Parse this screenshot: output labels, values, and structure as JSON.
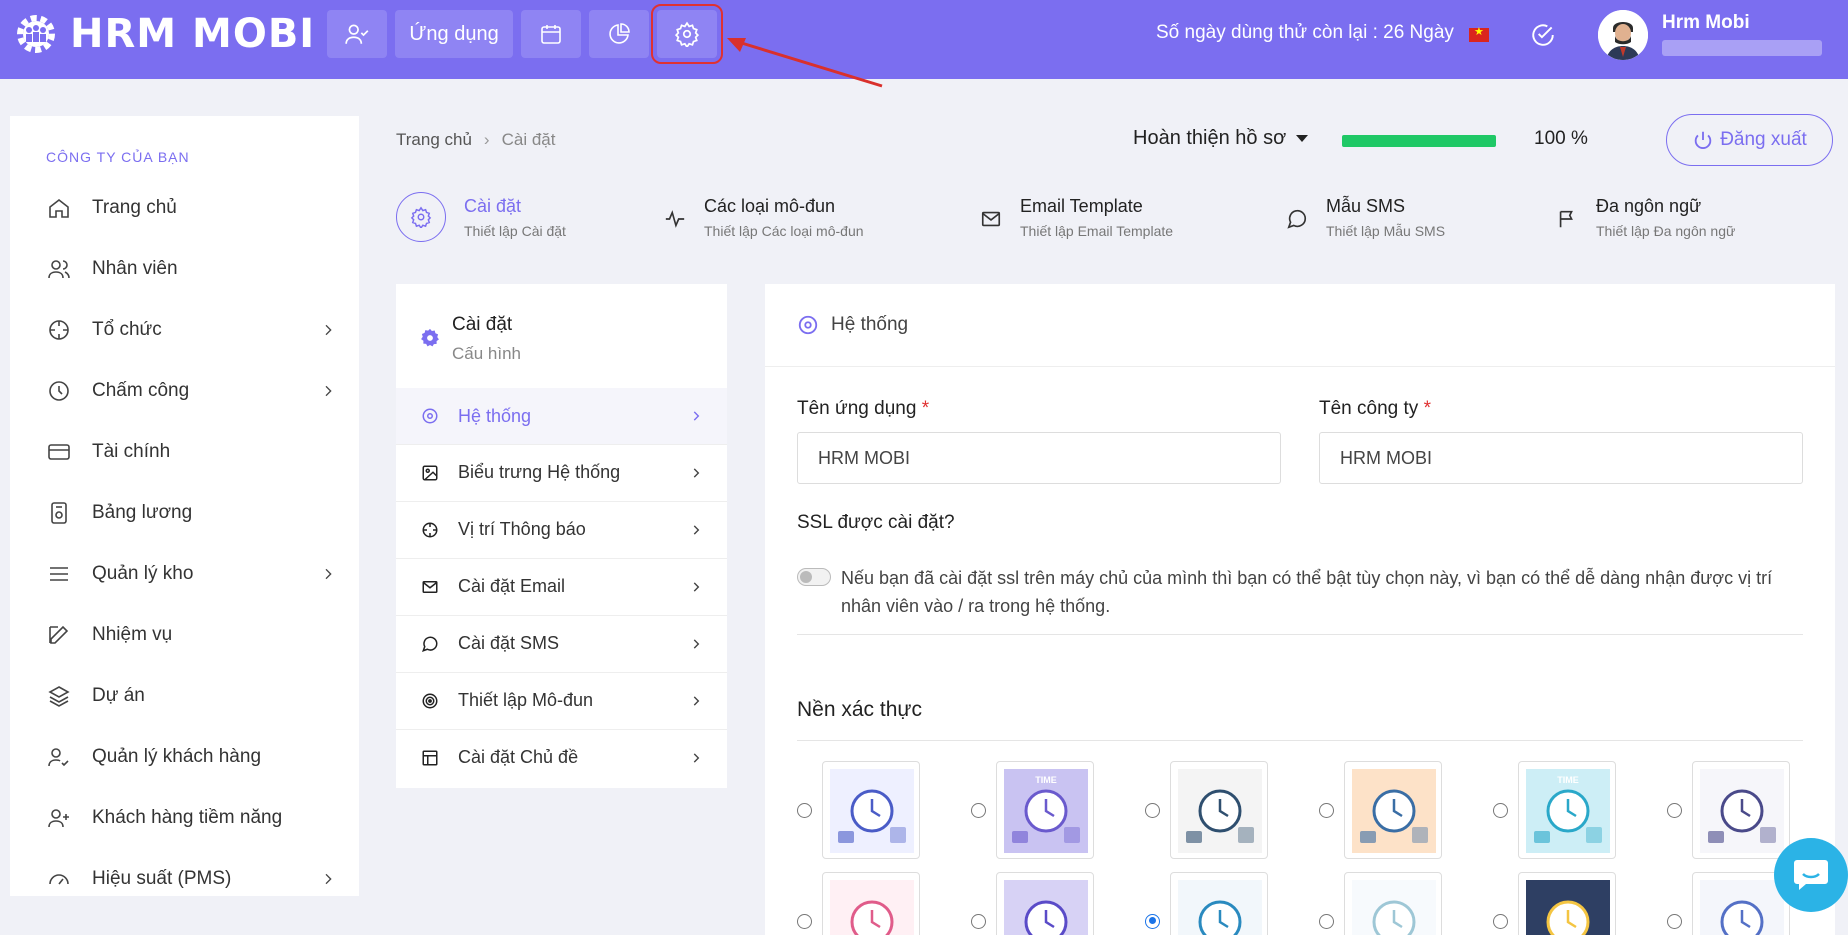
{
  "app": {
    "logo": "HRM MOBI"
  },
  "topbar": {
    "apps_label": "Ứng dụng",
    "trial_text": "Số ngày dùng thử còn lại : 26 Ngày",
    "user_name": "Hrm Mobi"
  },
  "sidebar": {
    "company": "CÔNG TY CỦA BẠN",
    "items": [
      {
        "label": "Trang chủ",
        "icon": "home-icon"
      },
      {
        "label": "Nhân viên",
        "icon": "users-icon"
      },
      {
        "label": "Tổ chức",
        "icon": "crosshair-icon",
        "chevron": true
      },
      {
        "label": "Chấm công",
        "icon": "clock-icon",
        "chevron": true
      },
      {
        "label": "Tài chính",
        "icon": "credit-card-icon"
      },
      {
        "label": "Bảng lương",
        "icon": "payroll-icon"
      },
      {
        "label": "Quản lý kho",
        "icon": "menu-icon",
        "chevron": true
      },
      {
        "label": "Nhiệm vụ",
        "icon": "edit-icon"
      },
      {
        "label": "Dự án",
        "icon": "layers-icon"
      },
      {
        "label": "Quản lý khách hàng",
        "icon": "user-check-icon"
      },
      {
        "label": "Khách hàng tiềm năng",
        "icon": "user-plus-icon"
      },
      {
        "label": "Hiệu suất (PMS)",
        "icon": "gauge-icon",
        "chevron": true
      }
    ]
  },
  "breadcrumb": {
    "home": "Trang chủ",
    "current": "Cài đặt"
  },
  "profile": {
    "label": "Hoàn thiện hồ sơ",
    "percent_text": "100 %",
    "progress": 1.0
  },
  "logout_label": "Đăng xuất",
  "tabs": [
    {
      "title": "Cài đặt",
      "subtitle": "Thiết lập Cài đặt"
    },
    {
      "title": "Các loại mô-đun",
      "subtitle": "Thiết lập Các loại mô-đun"
    },
    {
      "title": "Email Template",
      "subtitle": "Thiết lập Email Template"
    },
    {
      "title": "Mẫu SMS",
      "subtitle": "Thiết lập Mẫu SMS"
    },
    {
      "title": "Đa ngôn ngữ",
      "subtitle": "Thiết lập Đa ngôn ngữ"
    }
  ],
  "settings_menu": {
    "title": "Cài đặt",
    "subtitle": "Cấu hình",
    "items": [
      {
        "label": "Hệ thống",
        "icon": "target-icon"
      },
      {
        "label": "Biểu trưng Hệ thống",
        "icon": "image-icon"
      },
      {
        "label": "Vị trí Thông báo",
        "icon": "crosshair-icon"
      },
      {
        "label": "Cài đặt Email",
        "icon": "mail-icon"
      },
      {
        "label": "Cài đặt SMS",
        "icon": "message-icon"
      },
      {
        "label": "Thiết lập Mô-đun",
        "icon": "bullseye-icon"
      },
      {
        "label": "Cài đặt Chủ đề",
        "icon": "layout-icon"
      }
    ]
  },
  "system": {
    "header": "Hệ thống",
    "app_name_label": "Tên ứng dụng",
    "app_name_value": "HRM MOBI",
    "company_label": "Tên công ty",
    "company_value": "HRM MOBI",
    "required_mark": "*",
    "ssl_label": "SSL được cài đặt?",
    "ssl_desc": "Nếu bạn đã cài đặt ssl trên máy chủ của mình thì bạn có thể bật tùy chọn này, vì bạn có thể dễ dàng nhận được vị trí nhân viên vào / ra trong hệ thống.",
    "ssl_enabled": false,
    "background_title": "Nền xác thực",
    "selected_background": 8,
    "thumb_caption": "TIME"
  },
  "colors": {
    "accent": "#7b6ef0",
    "progress": "#1fc866",
    "chat": "#2bb3e6"
  }
}
